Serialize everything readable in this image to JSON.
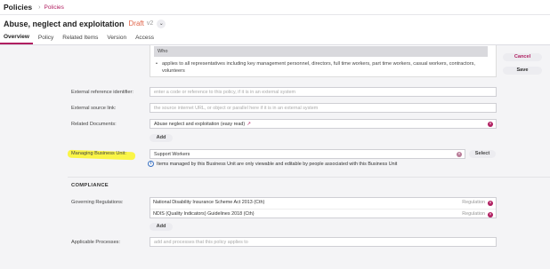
{
  "topbar": {
    "title": "Policies",
    "breadcrumb": "Policies"
  },
  "header": {
    "title": "Abuse, neglect and exploitation",
    "status": "Draft",
    "version": "v2"
  },
  "tabs": [
    {
      "label": "Overview",
      "active": true
    },
    {
      "label": "Policy"
    },
    {
      "label": "Related Items"
    },
    {
      "label": "Version"
    },
    {
      "label": "Access"
    }
  ],
  "actions": {
    "cancel_label": "Cancel",
    "save_label": "Save"
  },
  "scope_card": {
    "heading": "Who",
    "bullet": "applies to all representatives including key management personnel, directors, full time workers, part time workers, casual workers, contractors, volunteers"
  },
  "fields": {
    "external_reference": {
      "label": "External reference identifier:",
      "placeholder": "enter a code or reference to this policy, if it is in an external system"
    },
    "external_source": {
      "label": "External source link:",
      "placeholder": "the source internet URL, or object or parallel here if it is in an external system"
    },
    "related_documents": {
      "label": "Related Documents:",
      "value": "Abuse neglect and exploitation (easy read)",
      "add_label": "Add"
    },
    "managing_business_unit": {
      "label": "Managing Business Unit:",
      "value": "Support Workers",
      "select_label": "Select",
      "info": "Items managed by this Business Unit are only viewable and editable by people associated with this Business Unit"
    }
  },
  "compliance": {
    "title": "COMPLIANCE",
    "governing_label": "Governing Regulations:",
    "regulations": [
      {
        "name": "National Disability Insurance Scheme Act 2013 (Cth)",
        "type": "Regulation"
      },
      {
        "name": "NDIS (Quality Indicators) Guidelines 2018 (Cth)",
        "type": "Regulation"
      }
    ],
    "add_label": "Add",
    "processes_label": "Applicable Processes:",
    "processes_placeholder": "add and processes that this policy applies to"
  },
  "colors": {
    "accent": "#b01e60",
    "status": "#e0654a",
    "highlight": "#faf528"
  }
}
